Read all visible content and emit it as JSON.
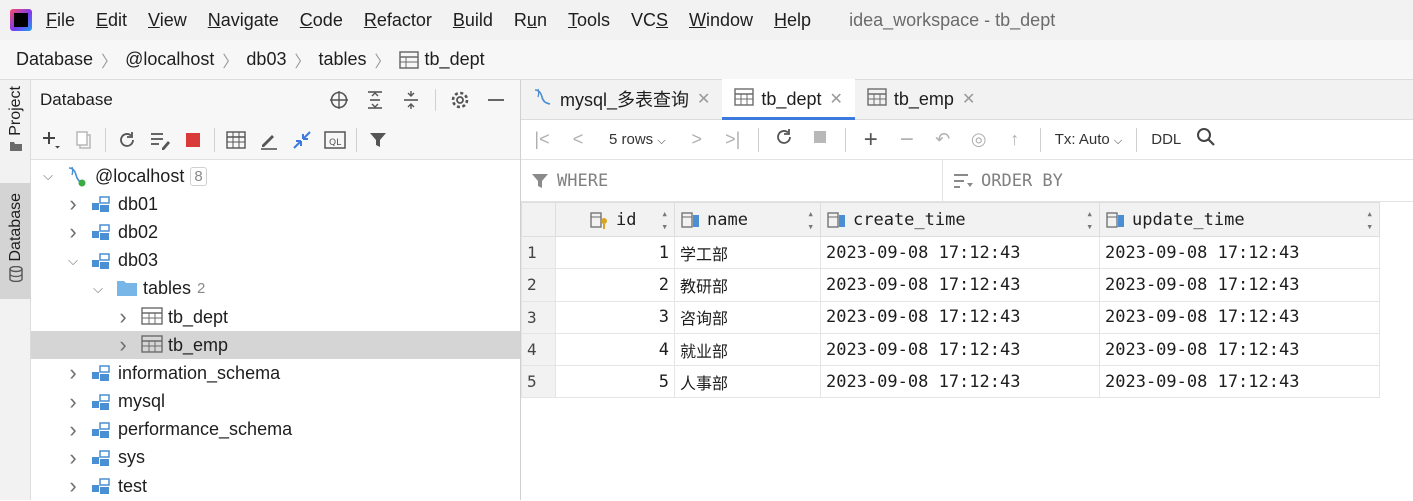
{
  "menubar": {
    "items": [
      "File",
      "Edit",
      "View",
      "Navigate",
      "Code",
      "Refactor",
      "Build",
      "Run",
      "Tools",
      "VCS",
      "Window",
      "Help"
    ],
    "mnemonics": [
      "F",
      "E",
      "V",
      "N",
      "C",
      "R",
      "B",
      "u",
      "T",
      "S",
      "W",
      "H"
    ],
    "window_title": "idea_workspace - tb_dept"
  },
  "breadcrumb": [
    "Database",
    "@localhost",
    "db03",
    "tables",
    "tb_dept"
  ],
  "stripe": {
    "project": "Project",
    "database": "Database"
  },
  "db_panel": {
    "title": "Database",
    "tree": [
      {
        "label": "@localhost",
        "count": "8",
        "level": 0,
        "expanded": true,
        "icon": "host-icon"
      },
      {
        "label": "db01",
        "level": 1,
        "expanded": false,
        "icon": "schema-icon"
      },
      {
        "label": "db02",
        "level": 1,
        "expanded": false,
        "icon": "schema-icon"
      },
      {
        "label": "db03",
        "level": 1,
        "expanded": true,
        "icon": "schema-icon"
      },
      {
        "label": "tables",
        "count": "2",
        "level": 2,
        "expanded": true,
        "icon": "folder-icon"
      },
      {
        "label": "tb_dept",
        "level": 3,
        "expanded": false,
        "icon": "table-icon"
      },
      {
        "label": "tb_emp",
        "level": 3,
        "expanded": false,
        "icon": "table-icon",
        "selected": true
      },
      {
        "label": "information_schema",
        "level": 1,
        "expanded": false,
        "icon": "schema-icon"
      },
      {
        "label": "mysql",
        "level": 1,
        "expanded": false,
        "icon": "schema-icon"
      },
      {
        "label": "performance_schema",
        "level": 1,
        "expanded": false,
        "icon": "schema-icon"
      },
      {
        "label": "sys",
        "level": 1,
        "expanded": false,
        "icon": "schema-icon"
      },
      {
        "label": "test",
        "level": 1,
        "expanded": false,
        "icon": "schema-icon"
      }
    ]
  },
  "tabs": [
    {
      "label": "mysql_多表查询",
      "icon": "console-icon",
      "active": false
    },
    {
      "label": "tb_dept",
      "icon": "table-icon",
      "active": true
    },
    {
      "label": "tb_emp",
      "icon": "table-icon",
      "active": false
    }
  ],
  "grid_toolbar": {
    "rows_label": "5 rows",
    "tx_label": "Tx: Auto",
    "ddl_label": "DDL"
  },
  "filter": {
    "where": "WHERE",
    "order_by": "ORDER BY"
  },
  "table": {
    "columns": [
      "id",
      "name",
      "create_time",
      "update_time"
    ],
    "rows": [
      [
        "1",
        "1",
        "学工部",
        "2023-09-08 17:12:43",
        "2023-09-08 17:12:43"
      ],
      [
        "2",
        "2",
        "教研部",
        "2023-09-08 17:12:43",
        "2023-09-08 17:12:43"
      ],
      [
        "3",
        "3",
        "咨询部",
        "2023-09-08 17:12:43",
        "2023-09-08 17:12:43"
      ],
      [
        "4",
        "4",
        "就业部",
        "2023-09-08 17:12:43",
        "2023-09-08 17:12:43"
      ],
      [
        "5",
        "5",
        "人事部",
        "2023-09-08 17:12:43",
        "2023-09-08 17:12:43"
      ]
    ]
  },
  "colors": {
    "accent": "#3c7bdd",
    "selection": "#d5d5d5",
    "schema_icon": "#4a8fd4",
    "folder_icon": "#79b6e8",
    "stop": "#d93b3b"
  }
}
